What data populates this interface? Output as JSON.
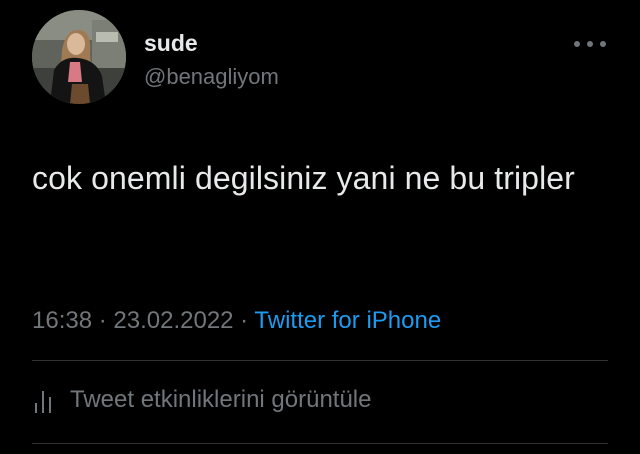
{
  "user": {
    "display_name": "sude",
    "handle": "@benagliyom"
  },
  "tweet": {
    "text": "cok onemli degilsiniz yani ne bu tripler",
    "time": "16:38",
    "separator": " · ",
    "date": "23.02.2022",
    "source": "Twitter for iPhone"
  },
  "actions": {
    "activity_label": "Tweet etkinliklerini görüntüle"
  },
  "icons": {
    "more": "more-horizontal-icon",
    "activity": "bar-chart-icon"
  },
  "colors": {
    "background": "#000000",
    "primary_text": "#e7e9ea",
    "secondary_text": "#71767b",
    "link": "#1d9bf0",
    "divider": "#2f3336"
  }
}
